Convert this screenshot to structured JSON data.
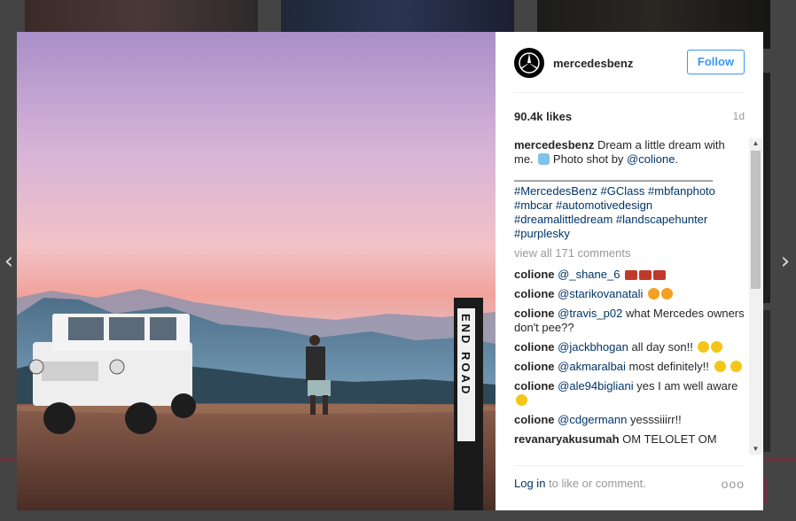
{
  "nav": {
    "prev_icon": "‹",
    "next_icon": "›"
  },
  "post": {
    "username": "mercedesbenz",
    "follow_label": "Follow",
    "likes": "90.4k likes",
    "time": "1d",
    "caption": {
      "user": "mercedesbenz",
      "text_1": "Dream a little dream with me.",
      "text_2": "Photo shot by",
      "mention": "@colione",
      "text_3": ".",
      "separator": "_______________________________",
      "hashtags": "#MercedesBenz #GClass #mbfanphoto #mbcar #automotivedesign #dreamalittledream #landscapehunter #purplesky"
    },
    "view_all": "view all 171 comments",
    "comments": [
      {
        "user": "colione",
        "mention": "@_shane_6",
        "text": ""
      },
      {
        "user": "colione",
        "mention": "@starikovanatali",
        "text": ""
      },
      {
        "user": "colione",
        "mention": "@travis_p02",
        "text": "what Mercedes owners don't pee??"
      },
      {
        "user": "colione",
        "mention": "@jackbhogan",
        "text": "all day son!!"
      },
      {
        "user": "colione",
        "mention": "@akmaralbai",
        "text": "most definitely!!"
      },
      {
        "user": "colione",
        "mention": "@ale94bigliani",
        "text": "yes I am well aware"
      },
      {
        "user": "colione",
        "mention": "@cdgermann",
        "text": "yesssiiirr!!"
      },
      {
        "user": "revanaryakusumah",
        "mention": "",
        "text": "OM TELOLET OM"
      }
    ],
    "footer": {
      "login": "Log in",
      "rest": "to like or comment.",
      "more": "ooo"
    }
  },
  "photo": {
    "sign_text": "END ROAD"
  },
  "colors": {
    "accent": "#3897f0",
    "link": "#003569",
    "muted": "#999999"
  }
}
